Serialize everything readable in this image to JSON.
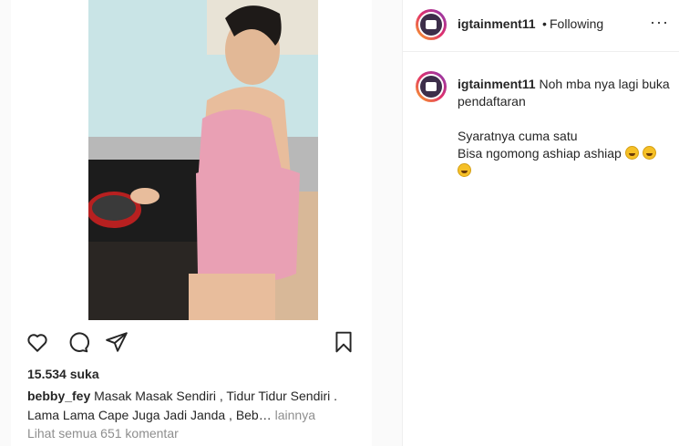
{
  "post": {
    "likes": "15.534 suka",
    "caption_user": "bebby_fey",
    "caption_text": "Masak Masak Sendiri , Tidur Tidur Sendiri . Lama Lama Cape Juga Jadi Janda , Beb…",
    "caption_more": "lainnya",
    "view_comments": "Lihat semua 651 komentar"
  },
  "panel": {
    "username": "igtainment11",
    "separator": "•",
    "follow_status": "Following",
    "more_label": "···",
    "comment": {
      "username": "igtainment11",
      "line1": "Noh mba nya lagi buka pendaftaran",
      "line2": "Syaratnya cuma satu",
      "line3": "Bisa ngomong ashiap ashiap"
    }
  },
  "colors": {
    "text": "#262626",
    "muted": "#8e8e8e",
    "border": "#efefef",
    "dress": "#e9a0b4"
  },
  "icons": [
    "heart-icon",
    "comment-icon",
    "share-icon",
    "bookmark-icon",
    "grinning-emoji-icon"
  ]
}
